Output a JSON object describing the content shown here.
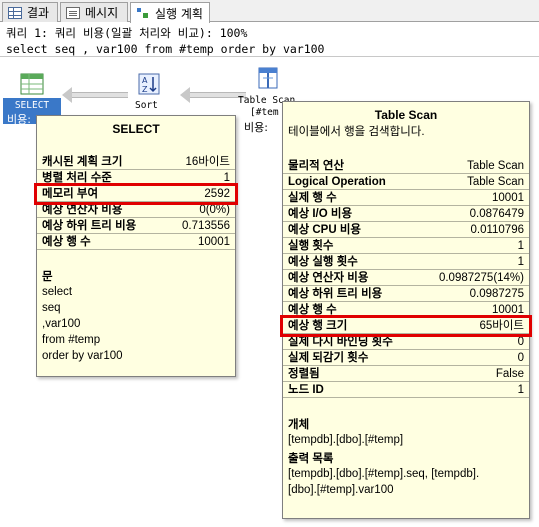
{
  "tabs": [
    {
      "label": "결과",
      "icon": "grid-icon"
    },
    {
      "label": "메시지",
      "icon": "message-icon"
    },
    {
      "label": "실행 계획",
      "icon": "plan-icon"
    }
  ],
  "query": {
    "header": "쿼리 1: 쿼리 비용(일괄 처리와 비교): 100%",
    "sql": "select seq , var100 from #temp order by var100"
  },
  "plan": {
    "select_label": "SELECT",
    "select_cost": "비용:",
    "sort_label": "Sort",
    "scan_label": "Table Scan",
    "scan_sub": "[#tem",
    "scan_cost": "비용:"
  },
  "select_tip": {
    "title": "SELECT",
    "rows": [
      {
        "k": "캐시된 계획 크기",
        "v": "16바이트"
      },
      {
        "k": "병렬 처리 수준",
        "v": "1"
      },
      {
        "k": "메모리 부여",
        "v": "2592"
      },
      {
        "k": "예상 연산자 비용",
        "v": "0(0%)"
      },
      {
        "k": "예상 하위 트리 비용",
        "v": "0.713556"
      },
      {
        "k": "예상 행 수",
        "v": "10001"
      }
    ],
    "statement_header": "문",
    "statement_lines": [
      "select",
      "seq",
      ",var100",
      "from #temp",
      "order by var100"
    ]
  },
  "scan_tip": {
    "title": "Table Scan",
    "desc": "테이블에서 행을 검색합니다.",
    "rows": [
      {
        "k": "물리적 연산",
        "v": "Table Scan"
      },
      {
        "k": "Logical Operation",
        "v": "Table Scan"
      },
      {
        "k": "실제 행 수",
        "v": "10001"
      },
      {
        "k": "예상 I/O 비용",
        "v": "0.0876479"
      },
      {
        "k": "예상 CPU 비용",
        "v": "0.0110796"
      },
      {
        "k": "실행 횟수",
        "v": "1"
      },
      {
        "k": "예상 실행 횟수",
        "v": "1"
      },
      {
        "k": "예상 연산자 비용",
        "v": "0.0987275(14%)"
      },
      {
        "k": "예상 하위 트리 비용",
        "v": "0.0987275"
      },
      {
        "k": "예상 행 수",
        "v": "10001"
      },
      {
        "k": "예상 행 크기",
        "v": "65바이트"
      },
      {
        "k": "실제 다시 바인딩 횟수",
        "v": "0"
      },
      {
        "k": "실제 되감기 횟수",
        "v": "0"
      },
      {
        "k": "정렬됨",
        "v": "False"
      },
      {
        "k": "노드 ID",
        "v": "1"
      }
    ],
    "object_header": "개체",
    "object_value": "[tempdb].[dbo].[#temp]",
    "output_header": "출력 목록",
    "output_lines": [
      "[tempdb].[dbo].[#temp].seq, [tempdb].",
      "[dbo].[#temp].var100"
    ]
  },
  "colors": {
    "tooltip_bg": "#ffffe1",
    "highlight": "#e00000",
    "select_bg": "#3a78c8"
  }
}
